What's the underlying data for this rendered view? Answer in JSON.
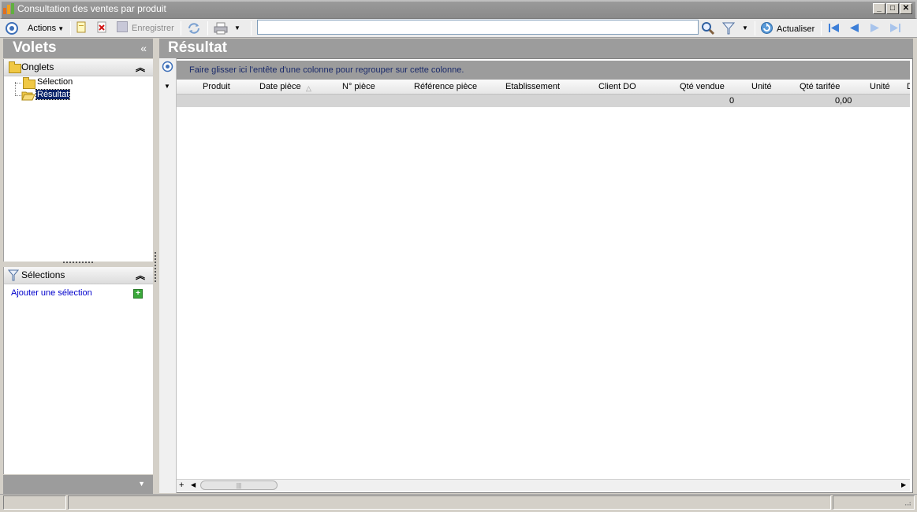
{
  "window": {
    "title": "Consultation des ventes par produit"
  },
  "toolbar": {
    "actions_label": "Actions",
    "save_label": "Enregistrer",
    "refresh_label": "Actualiser",
    "search_value": ""
  },
  "left_panel": {
    "title": "Volets",
    "collapse_glyph": "«",
    "tabs_section": {
      "title": "Onglets",
      "items": [
        {
          "label": "Sélection",
          "selected": false
        },
        {
          "label": "Résultat",
          "selected": true
        }
      ]
    },
    "selections_section": {
      "title": "Sélections",
      "add_link": "Ajouter une sélection"
    }
  },
  "main": {
    "title": "Résultat",
    "group_hint": "Faire glisser ici l'entête d'une colonne pour regrouper sur cette colonne.",
    "columns": [
      "Produit",
      "Date pièce",
      "N° pièce",
      "Référence pièce",
      "Etablissement",
      "Client DO",
      "Qté vendue",
      "Unité",
      "Qté tarifée",
      "Unité",
      "D"
    ],
    "summary": {
      "qte_vendue": "0",
      "qte_tarifee": "0,00"
    }
  },
  "icons": {
    "app": "app-logo-icon",
    "actions": "circle-target-icon",
    "new": "new-document-icon",
    "delete": "delete-icon",
    "save": "save-icon",
    "sync": "sync-icon",
    "print": "print-icon",
    "search": "magnifier-icon",
    "filter": "filter-icon",
    "refresh": "refresh-icon",
    "nav": [
      "first-page-icon",
      "previous-page-icon",
      "next-page-icon",
      "last-page-icon"
    ]
  },
  "colors": {
    "panel_header": "#9c9c9c",
    "title_bar": "#8a8a8a",
    "link": "#0000cc",
    "selection_highlight": "#0a246a",
    "nav_blue": "#3d7fd8"
  }
}
